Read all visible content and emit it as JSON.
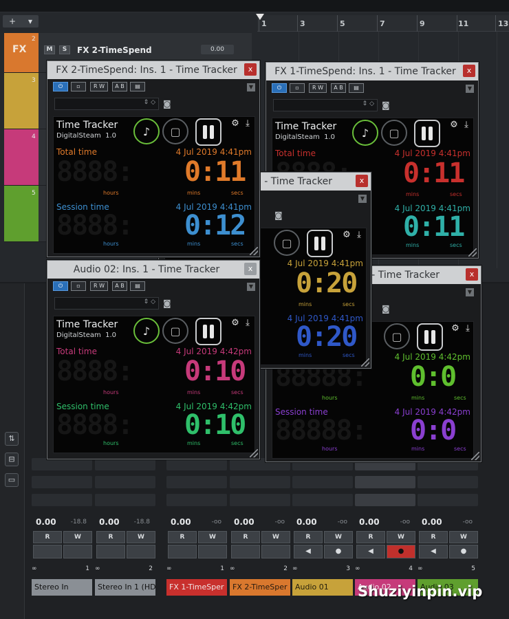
{
  "project": {
    "toolbar_plus": "+",
    "toolbar_arrow": "▾",
    "ruler": [
      "1",
      "3",
      "5",
      "7",
      "9",
      "11",
      "13"
    ],
    "fx_track": {
      "label": "FX",
      "number": "2",
      "mute": "M",
      "solo": "S",
      "name": "FX 2-TimeSpend",
      "value": "0.00",
      "color": "#d9782e"
    },
    "tracks": [
      {
        "number": "3",
        "color": "#c7a23a"
      },
      {
        "number": "4",
        "color": "#c63a7a"
      },
      {
        "number": "5",
        "color": "#5f9f2e"
      }
    ]
  },
  "mixer": {
    "channels": [
      {
        "vol": "0.00",
        "peak": "-18.8",
        "num": "1",
        "name": "Stereo In",
        "color": "#8a8f95"
      },
      {
        "vol": "0.00",
        "peak": "-18.8",
        "num": "2",
        "name": "Stereo In 1 (HD",
        "color": "#8a8f95"
      },
      {
        "vol": "0.00",
        "peak": "-oo",
        "num": "1",
        "name": "FX 1-TimeSper",
        "color": "#c8302d"
      },
      {
        "vol": "0.00",
        "peak": "-oo",
        "num": "2",
        "name": "FX 2-TimeSper",
        "color": "#d9782e"
      },
      {
        "vol": "0.00",
        "peak": "-oo",
        "num": "3",
        "name": "Audio 01",
        "color": "#c7a23a"
      },
      {
        "vol": "0.00",
        "peak": "-oo",
        "num": "4",
        "name": "Audio 02",
        "color": "#c63a7a"
      },
      {
        "vol": "0.00",
        "peak": "-oo",
        "num": "5",
        "name": "Audio 03",
        "color": "#5f9f2e"
      }
    ],
    "read": "R",
    "write": "W"
  },
  "plugins": {
    "common": {
      "product": "Time Tracker",
      "vendor": "DigitalSteam",
      "version": "1.0",
      "total_label": "Total time",
      "session_label": "Session time",
      "hours": "hours",
      "mins": "mins",
      "secs": "secs",
      "close": "x",
      "rw": "R W",
      "ab": "A B",
      "menu": "▼"
    },
    "fx2": {
      "title": "FX 2-TimeSpend: Ins. 1 - Time Tracker",
      "total_date": "4 Jul 2019 4:41pm",
      "session_date": "4 Jul 2019 4:41pm",
      "total_digits": "0:11",
      "session_digits": "0:12",
      "total_color": "#e07a2a",
      "session_color": "#3d8fd0"
    },
    "fx1": {
      "title": "FX 1-TimeSpend: Ins. 1 - Time Tracker",
      "total_date": "4 Jul 2019 4:41pm",
      "session_date": "4 Jul 2019 4:41pm",
      "total_digits": "0:11",
      "session_digits": "0:11",
      "total_color": "#c8302d",
      "session_color": "#2fb0a8"
    },
    "mid": {
      "title": "- Time Tracker",
      "total_date": "4 Jul 2019 4:41pm",
      "session_date": "4 Jul 2019 4:41pm",
      "total_digits": "0:20",
      "session_digits": "0:20",
      "total_color": "#c7a23a",
      "session_color": "#2f58c8"
    },
    "audio3": {
      "title": "- Time Tracker",
      "total_date": "4 Jul 2019 4:42pm",
      "session_date": "4 Jul 2019 4:42pm",
      "total_digits": "0:0",
      "session_digits": "0:0",
      "total_color": "#5fbf2e",
      "session_color": "#8a3fd0"
    },
    "audio2": {
      "title": "Audio 02: Ins. 1 - Time Tracker",
      "total_date": "4 Jul 2019 4:42pm",
      "session_date": "4 Jul 2019 4:42pm",
      "total_digits": "0:10",
      "session_digits": "0:10",
      "total_color": "#c63a7a",
      "session_color": "#2fbf6a"
    }
  },
  "watermark": "Shuziyinpin.vip"
}
